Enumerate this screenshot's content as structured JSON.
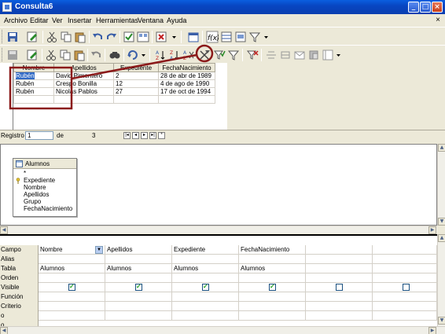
{
  "window": {
    "title": "Consulta6"
  },
  "menu": [
    "Archivo",
    "Editar",
    "Ver",
    "Insertar",
    "Herramientas",
    "Ventana",
    "Ayuda"
  ],
  "results": {
    "columns": [
      "Nombre",
      "Apellidos",
      "Expediente",
      "FechaNacimiento"
    ],
    "rows": [
      [
        "Rubén",
        "David Pimentero",
        "2",
        "28 de abr de 1989"
      ],
      [
        "Rubén",
        "Crespo Bonilla",
        "12",
        "4 de ago de 1990"
      ],
      [
        "Rubén",
        "Nicolas Pablos",
        "27",
        "17 de oct de 1994"
      ]
    ]
  },
  "navigation": {
    "registro_label": "Registro",
    "registro_value": "1",
    "de_label": "de",
    "total": "3"
  },
  "table_box": {
    "title": "Alumnos",
    "fields": [
      "*",
      "Expediente",
      "Nombre",
      "Apellidos",
      "Grupo",
      "FechaNacimiento"
    ]
  },
  "design_grid": {
    "row_labels": [
      "Campo",
      "Alias",
      "Tabla",
      "Orden",
      "Visible",
      "Función",
      "Criterio",
      "o",
      "o"
    ],
    "columns": [
      {
        "campo": "Nombre",
        "tabla": "Alumnos",
        "visible": true
      },
      {
        "campo": "Apellidos",
        "tabla": "Alumnos",
        "visible": true
      },
      {
        "campo": "Expediente",
        "tabla": "Alumnos",
        "visible": true
      },
      {
        "campo": "FechaNacimiento",
        "tabla": "Alumnos",
        "visible": true
      },
      {
        "campo": "",
        "tabla": "",
        "visible": false
      },
      {
        "campo": "",
        "tabla": "",
        "visible": false
      }
    ]
  },
  "colors": {
    "title_bar": "#0a4fd0",
    "selection": "#316ac5",
    "annotation": "#8b1a1a",
    "check": "#21a121"
  }
}
